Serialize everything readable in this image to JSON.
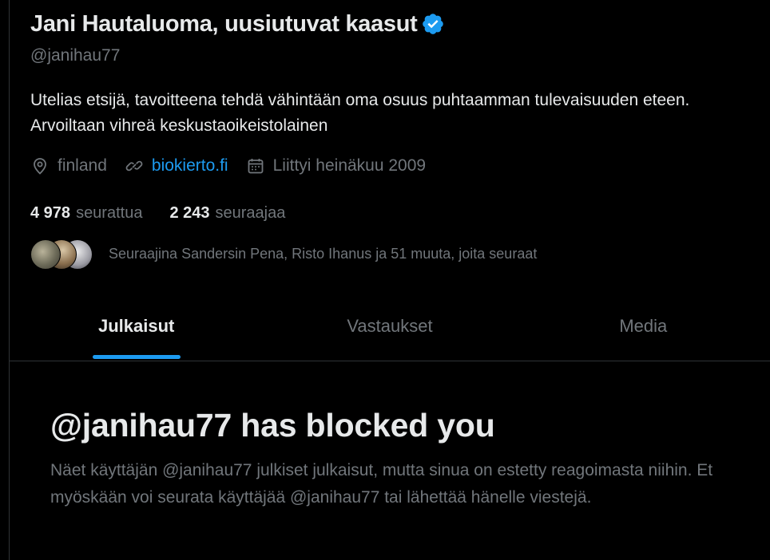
{
  "profile": {
    "display_name": "Jani Hautaluoma, uusiutuvat kaasut",
    "verified_icon": "verified-badge-icon",
    "handle": "@janihau77",
    "bio": "Utelias etsijä, tavoitteena tehdä vähintään oma osuus puhtaamman tulevaisuuden eteen. Arvoiltaan vihreä keskustaoikeistolainen",
    "location": "finland",
    "website": "biokierto.fi",
    "joined": "Liittyi heinäkuu 2009"
  },
  "stats": {
    "following_count": "4 978",
    "following_label": "seurattua",
    "followers_count": "2 243",
    "followers_label": "seuraajaa"
  },
  "followers_you_know": {
    "text": "Seuraajina Sandersin Pena, Risto Ihanus ja 51 muuta, joita seuraat"
  },
  "tabs": [
    {
      "label": "Julkaisut",
      "active": true
    },
    {
      "label": "Vastaukset",
      "active": false
    },
    {
      "label": "Media",
      "active": false
    }
  ],
  "blocked": {
    "title": "@janihau77 has blocked you",
    "message": "Näet käyttäjän @janihau77 julkiset julkaisut, mutta sinua on estetty reagoimasta niihin. Et myöskään voi seurata käyttäjää @janihau77 tai lähettää hänelle viestejä."
  },
  "colors": {
    "background": "#000000",
    "text_primary": "#e7e9ea",
    "text_secondary": "#71767b",
    "accent": "#1d9bf0",
    "border": "#2f3336"
  }
}
